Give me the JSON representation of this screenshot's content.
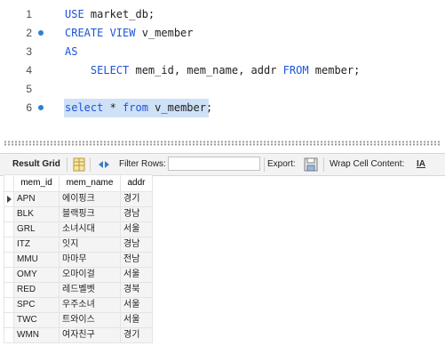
{
  "editor": {
    "lines": [
      {
        "num": "1",
        "parts": [
          {
            "t": "USE",
            "kw": true
          },
          {
            "t": " market_db;",
            "kw": false
          }
        ],
        "dot": false,
        "selected": false
      },
      {
        "num": "2",
        "parts": [
          {
            "t": "CREATE VIEW",
            "kw": true
          },
          {
            "t": " v_member",
            "kw": false
          }
        ],
        "dot": true,
        "selected": false
      },
      {
        "num": "3",
        "parts": [
          {
            "t": "AS",
            "kw": true
          }
        ],
        "dot": false,
        "selected": false
      },
      {
        "num": "4",
        "parts": [
          {
            "t": "    SELECT",
            "kw": true
          },
          {
            "t": " mem_id, mem_name, addr ",
            "kw": false
          },
          {
            "t": "FROM",
            "kw": true
          },
          {
            "t": " member;",
            "kw": false
          }
        ],
        "dot": false,
        "selected": false
      },
      {
        "num": "5",
        "parts": [],
        "dot": false,
        "selected": false
      },
      {
        "num": "6",
        "parts": [
          {
            "t": "select",
            "kw": true
          },
          {
            "t": " * ",
            "kw": false
          },
          {
            "t": "from",
            "kw": true
          },
          {
            "t": " v_member;",
            "kw": false
          }
        ],
        "dot": true,
        "selected": true
      }
    ]
  },
  "toolbar": {
    "result_grid": "Result Grid",
    "filter_rows": "Filter Rows:",
    "filter_value": "",
    "export": "Export:",
    "wrap_cell": "Wrap Cell Content:",
    "wrap_icon_glyph": "IA"
  },
  "grid": {
    "columns": [
      "mem_id",
      "mem_name",
      "addr"
    ],
    "rows": [
      [
        "APN",
        "에이핑크",
        "경기"
      ],
      [
        "BLK",
        "블랙핑크",
        "경남"
      ],
      [
        "GRL",
        "소녀시대",
        "서울"
      ],
      [
        "ITZ",
        "잇지",
        "경남"
      ],
      [
        "MMU",
        "마마무",
        "전남"
      ],
      [
        "OMY",
        "오마이걸",
        "서울"
      ],
      [
        "RED",
        "레드벨벳",
        "경북"
      ],
      [
        "SPC",
        "우주소녀",
        "서울"
      ],
      [
        "TWC",
        "트와이스",
        "서울"
      ],
      [
        "WMN",
        "여자친구",
        "경기"
      ]
    ]
  },
  "colors": {
    "keyword": "#1c54d6",
    "selection": "#cfe1f7",
    "breakpoint_dot": "#2f7fd3"
  }
}
